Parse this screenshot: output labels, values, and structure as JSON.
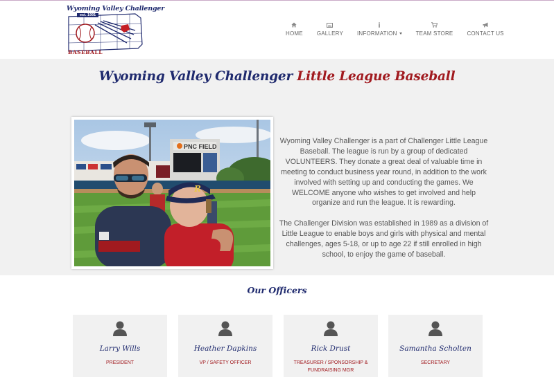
{
  "logo": {
    "title": "Wyoming Valley Challenger",
    "est": "est. 1991",
    "subtitle": "BASEBALL"
  },
  "nav": {
    "items": [
      {
        "label": "HOME",
        "icon": "home-icon"
      },
      {
        "label": "GALLERY",
        "icon": "image-icon"
      },
      {
        "label": "INFORMATION",
        "icon": "info-icon",
        "dropdown": true
      },
      {
        "label": "TEAM STORE",
        "icon": "cart-icon"
      },
      {
        "label": "CONTACT US",
        "icon": "bullhorn-icon"
      }
    ]
  },
  "hero": {
    "title_part1": "Wyoming Valley Challenger",
    "title_part2": "Little League Baseball",
    "photo_sign": "PNC FIELD",
    "paragraph1": "Wyoming Valley Challenger is a part of Challenger Little League Baseball. The league is run by a group of dedicated VOLUNTEERS. They donate a great deal of valuable time in meeting to conduct business year round, in addition to the work involved with setting up and conducting the games. We WELCOME anyone who wishes to get involved and help organize and run the league. It is rewarding.",
    "paragraph2": "The Challenger Division was established in 1989 as a division of Little League to enable boys and girls with physical and mental challenges, ages 5-18, or up to age 22 if still enrolled in high school, to enjoy the game of baseball."
  },
  "officers": {
    "title": "Our Officers",
    "list": [
      {
        "name": "Larry Wills",
        "role": "PRESIDENT"
      },
      {
        "name": "Heather Dapkins",
        "role": "VP / SAFETY OFFICER"
      },
      {
        "name": "Rick Drust",
        "role": "TREASURER / SPONSORSHIP & FUNDRAISING MGR"
      },
      {
        "name": "Samantha Scholten",
        "role": "SECRETARY"
      }
    ]
  },
  "colors": {
    "navy": "#1f2a6e",
    "maroon": "#a11a1f",
    "section_bg": "#f1f1f1"
  }
}
